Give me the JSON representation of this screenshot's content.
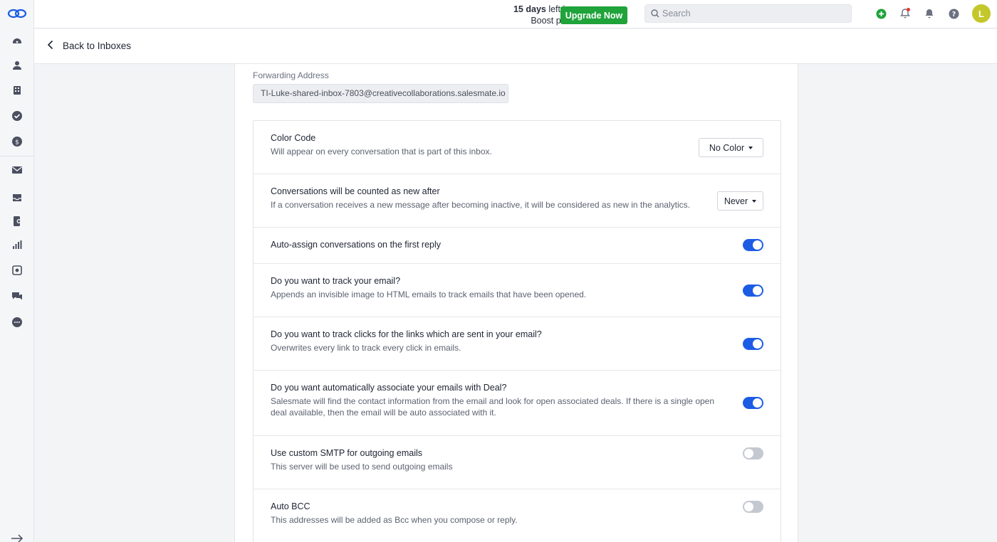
{
  "topbar": {
    "trial_days": "15 days",
    "trial_rest": " left in your",
    "trial_plan": "Boost plan trial",
    "upgrade_label": "Upgrade Now",
    "search_placeholder": "Search",
    "avatar_initial": "L"
  },
  "subheader": {
    "back_label": "Back to Inboxes"
  },
  "forwarding": {
    "label": "Forwarding Address",
    "value": "TI-Luke-shared-inbox-7803@creativecollaborations.salesmate.io"
  },
  "settings": {
    "color_code": {
      "title": "Color Code",
      "desc": "Will appear on every conversation that is part of this inbox.",
      "selected": "No Color"
    },
    "counted_new": {
      "title": "Conversations will be counted as new after",
      "desc": "If a conversation receives a new message after becoming inactive, it will be considered as new in the analytics.",
      "selected": "Never"
    },
    "auto_assign": {
      "title": "Auto-assign conversations on the first reply",
      "enabled": true
    },
    "track_email": {
      "title": "Do you want to track your email?",
      "desc": "Appends an invisible image to HTML emails to track emails that have been opened.",
      "enabled": true
    },
    "track_clicks": {
      "title": "Do you want to track clicks for the links which are sent in your email?",
      "desc": "Overwrites every link to track every click in emails.",
      "enabled": true
    },
    "associate_deal": {
      "title": "Do you want automatically associate your emails with Deal?",
      "desc": "Salesmate will find the contact information from the email and look for open associated deals. If there is a single open deal available, then the email will be auto associated with it.",
      "enabled": true
    },
    "custom_smtp": {
      "title": "Use custom SMTP for outgoing emails",
      "desc": "This server will be used to send outgoing emails",
      "enabled": false
    },
    "auto_bcc": {
      "title": "Auto BCC",
      "desc": "This addresses will be added as Bcc when you compose or reply.",
      "enabled": false
    }
  },
  "colors": {
    "accent": "#1c5ce5",
    "upgrade_green": "#1fa33a",
    "avatar": "#c4c72a",
    "notification_dot": "#e53935"
  }
}
